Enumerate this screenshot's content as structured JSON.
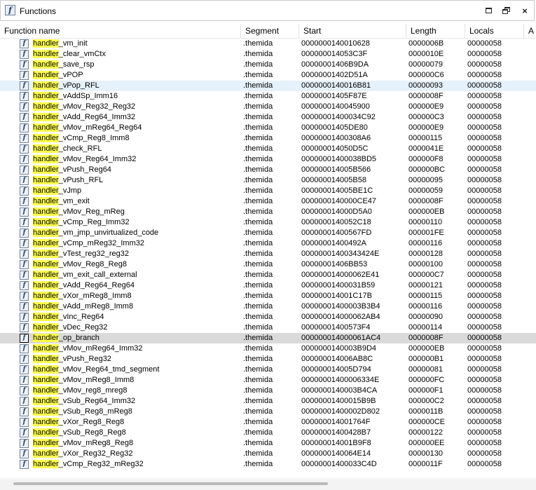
{
  "window": {
    "title": "Functions",
    "app_icon_glyph": "f",
    "controls": {
      "maximize": "maximize-icon",
      "restore": "restore-icon",
      "close": "×"
    }
  },
  "columns": [
    "Function name",
    "Segment",
    "Start",
    "Length",
    "Locals",
    "A"
  ],
  "highlight_term": "handler",
  "colors": {
    "highlight": "#ffff4d",
    "row_selected": "#e5f1fb",
    "row_focused": "#dadada"
  },
  "rows": [
    {
      "name_rest": "_vm_init",
      "segment": ".themida",
      "start": "0000000140010628",
      "length": "0000006B",
      "locals": "00000058"
    },
    {
      "name_rest": "_clear_vmCtx",
      "segment": ".themida",
      "start": "000000014053C3F",
      "length": "0000010E",
      "locals": "00000058"
    },
    {
      "name_rest": "_save_rsp",
      "segment": ".themida",
      "start": "00000001406B9DA",
      "length": "00000079",
      "locals": "00000058"
    },
    {
      "name_rest": "_vPOP",
      "segment": ".themida",
      "start": "00000001402D51A",
      "length": "000000C6",
      "locals": "00000058"
    },
    {
      "name_rest": "_vPop_RFL",
      "segment": ".themida",
      "start": "0000000140016B81",
      "length": "00000093",
      "locals": "00000058"
    },
    {
      "name_rest": "_vAddSp_Imm16",
      "segment": ".themida",
      "start": "00000001405F87E",
      "length": "0000008F",
      "locals": "00000058"
    },
    {
      "name_rest": "_vMov_Reg32_Reg32",
      "segment": ".themida",
      "start": "0000000140045900",
      "length": "000000E9",
      "locals": "00000058"
    },
    {
      "name_rest": "_vAdd_Reg64_Imm32",
      "segment": ".themida",
      "start": "00000001400034C92",
      "length": "000000C3",
      "locals": "00000058"
    },
    {
      "name_rest": "_vMov_mReg64_Reg64",
      "segment": ".themida",
      "start": "00000001405DE80",
      "length": "000000E9",
      "locals": "00000058"
    },
    {
      "name_rest": "_vCmp_Reg8_Imm8",
      "segment": ".themida",
      "start": "00000001400308A6",
      "length": "00000115",
      "locals": "00000058"
    },
    {
      "name_rest": "_check_RFL",
      "segment": ".themida",
      "start": "000000014050D5C",
      "length": "0000041E",
      "locals": "00000058"
    },
    {
      "name_rest": "_vMov_Reg64_Imm32",
      "segment": ".themida",
      "start": "00000001400038BD5",
      "length": "000000F8",
      "locals": "00000058"
    },
    {
      "name_rest": "_vPush_Reg64",
      "segment": ".themida",
      "start": "000000014005B566",
      "length": "000000BC",
      "locals": "00000058"
    },
    {
      "name_rest": "_vPush_RFL",
      "segment": ".themida",
      "start": "000000014005B58",
      "length": "00000095",
      "locals": "00000058"
    },
    {
      "name_rest": "_vJmp",
      "segment": ".themida",
      "start": "000000014005BE1C",
      "length": "00000059",
      "locals": "00000058"
    },
    {
      "name_rest": "_vm_exit",
      "segment": ".themida",
      "start": "0000000140000CE47",
      "length": "0000008F",
      "locals": "00000058"
    },
    {
      "name_rest": "_vMov_Reg_mReg",
      "segment": ".themida",
      "start": "000000014000D5A0",
      "length": "000000EB",
      "locals": "00000058"
    },
    {
      "name_rest": "_vCmp_Reg_Imm32",
      "segment": ".themida",
      "start": "0000000140052C18",
      "length": "00000110",
      "locals": "00000058"
    },
    {
      "name_rest": "_vm_jmp_unvirtualized_code",
      "segment": ".themida",
      "start": "00000001400567FD",
      "length": "000001FE",
      "locals": "00000058"
    },
    {
      "name_rest": "_vCmp_mReg32_Imm32",
      "segment": ".themida",
      "start": "00000001400492A",
      "length": "00000116",
      "locals": "00000058"
    },
    {
      "name_rest": "_vTest_reg32_reg32",
      "segment": ".themida",
      "start": "00000001400343424E",
      "length": "00000128",
      "locals": "00000058"
    },
    {
      "name_rest": "_vMov_Reg8_Reg8",
      "segment": ".themida",
      "start": "00000001406BB53",
      "length": "00000100",
      "locals": "00000058"
    },
    {
      "name_rest": "_vm_exit_call_external",
      "segment": ".themida",
      "start": "000000014000062E41",
      "length": "000000C7",
      "locals": "00000058"
    },
    {
      "name_rest": "_vAdd_Reg64_Reg64",
      "segment": ".themida",
      "start": "00000001400031B59",
      "length": "00000121",
      "locals": "00000058"
    },
    {
      "name_rest": "_vXor_mReg8_Imm8",
      "segment": ".themida",
      "start": "000000014001C17B",
      "length": "00000115",
      "locals": "00000058"
    },
    {
      "name_rest": "_vAdd_mReg8_Imm8",
      "segment": ".themida",
      "start": "00000001400003B3B4",
      "length": "00000116",
      "locals": "00000058"
    },
    {
      "name_rest": "_vInc_Reg64",
      "segment": ".themida",
      "start": "000000014000062AB4",
      "length": "00000090",
      "locals": "00000058"
    },
    {
      "name_rest": "_vDec_Reg32",
      "segment": ".themida",
      "start": "00000001400573F4",
      "length": "00000114",
      "locals": "00000058"
    },
    {
      "name_rest": "_op_branch",
      "segment": ".themida",
      "start": "000000014000061AC4",
      "length": "0000008F",
      "locals": "00000058"
    },
    {
      "name_rest": "_vMov_mReg64_Imm32",
      "segment": ".themida",
      "start": "0000000140003B9D4",
      "length": "000000EB",
      "locals": "00000058"
    },
    {
      "name_rest": "_vPush_Reg32",
      "segment": ".themida",
      "start": "000000014006AB8C",
      "length": "000000B1",
      "locals": "00000058"
    },
    {
      "name_rest": "_vMov_Reg64_tmd_segment",
      "segment": ".themida",
      "start": "000000014005D794",
      "length": "00000081",
      "locals": "00000058"
    },
    {
      "name_rest": "_vMov_mReg8_Imm8",
      "segment": ".themida",
      "start": "00000001400006334E",
      "length": "000000FC",
      "locals": "00000058"
    },
    {
      "name_rest": "_vMov_reg8_mreg8",
      "segment": ".themida",
      "start": "0000000140003B4CA",
      "length": "000000F1",
      "locals": "00000058"
    },
    {
      "name_rest": "_vSub_Reg64_Imm32",
      "segment": ".themida",
      "start": "00000001400015B9B",
      "length": "000000C2",
      "locals": "00000058"
    },
    {
      "name_rest": "_vSub_Reg8_mReg8",
      "segment": ".themida",
      "start": "00000001400002D802",
      "length": "0000011B",
      "locals": "00000058"
    },
    {
      "name_rest": "_vXor_Reg8_Reg8",
      "segment": ".themida",
      "start": "000000014001764F",
      "length": "000000CE",
      "locals": "00000058"
    },
    {
      "name_rest": "_vSub_Reg8_Reg8",
      "segment": ".themida",
      "start": "00000001400428B7",
      "length": "00000122",
      "locals": "00000058"
    },
    {
      "name_rest": "_vMov_mReg8_Reg8",
      "segment": ".themida",
      "start": "000000014001B9F8",
      "length": "000000EE",
      "locals": "00000058"
    },
    {
      "name_rest": "_vXor_Reg32_Reg32",
      "segment": ".themida",
      "start": "0000000140064E14",
      "length": "00000130",
      "locals": "00000058"
    },
    {
      "name_rest": "_vCmp_Reg32_mReg32",
      "segment": ".themida",
      "start": "00000001400033C4D",
      "length": "0000011F",
      "locals": "00000058"
    }
  ]
}
